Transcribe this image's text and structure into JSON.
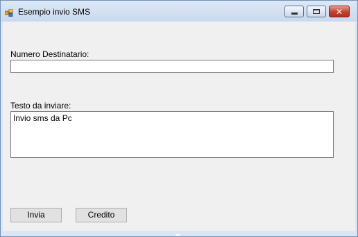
{
  "window": {
    "title": "Esempio invio SMS"
  },
  "form": {
    "recipient_label": "Numero Destinatario:",
    "recipient_value": "",
    "text_label": "Testo da inviare:",
    "text_value": "Invio sms da Pc"
  },
  "buttons": {
    "send_label": "Invia",
    "credit_label": "Credito"
  },
  "icons": {
    "app": "app-icon",
    "minimize": "minimize-icon",
    "maximize": "maximize-icon",
    "close": "close-icon"
  },
  "colors": {
    "close_button": "#c2402f",
    "form_background": "#f0f0f0"
  }
}
